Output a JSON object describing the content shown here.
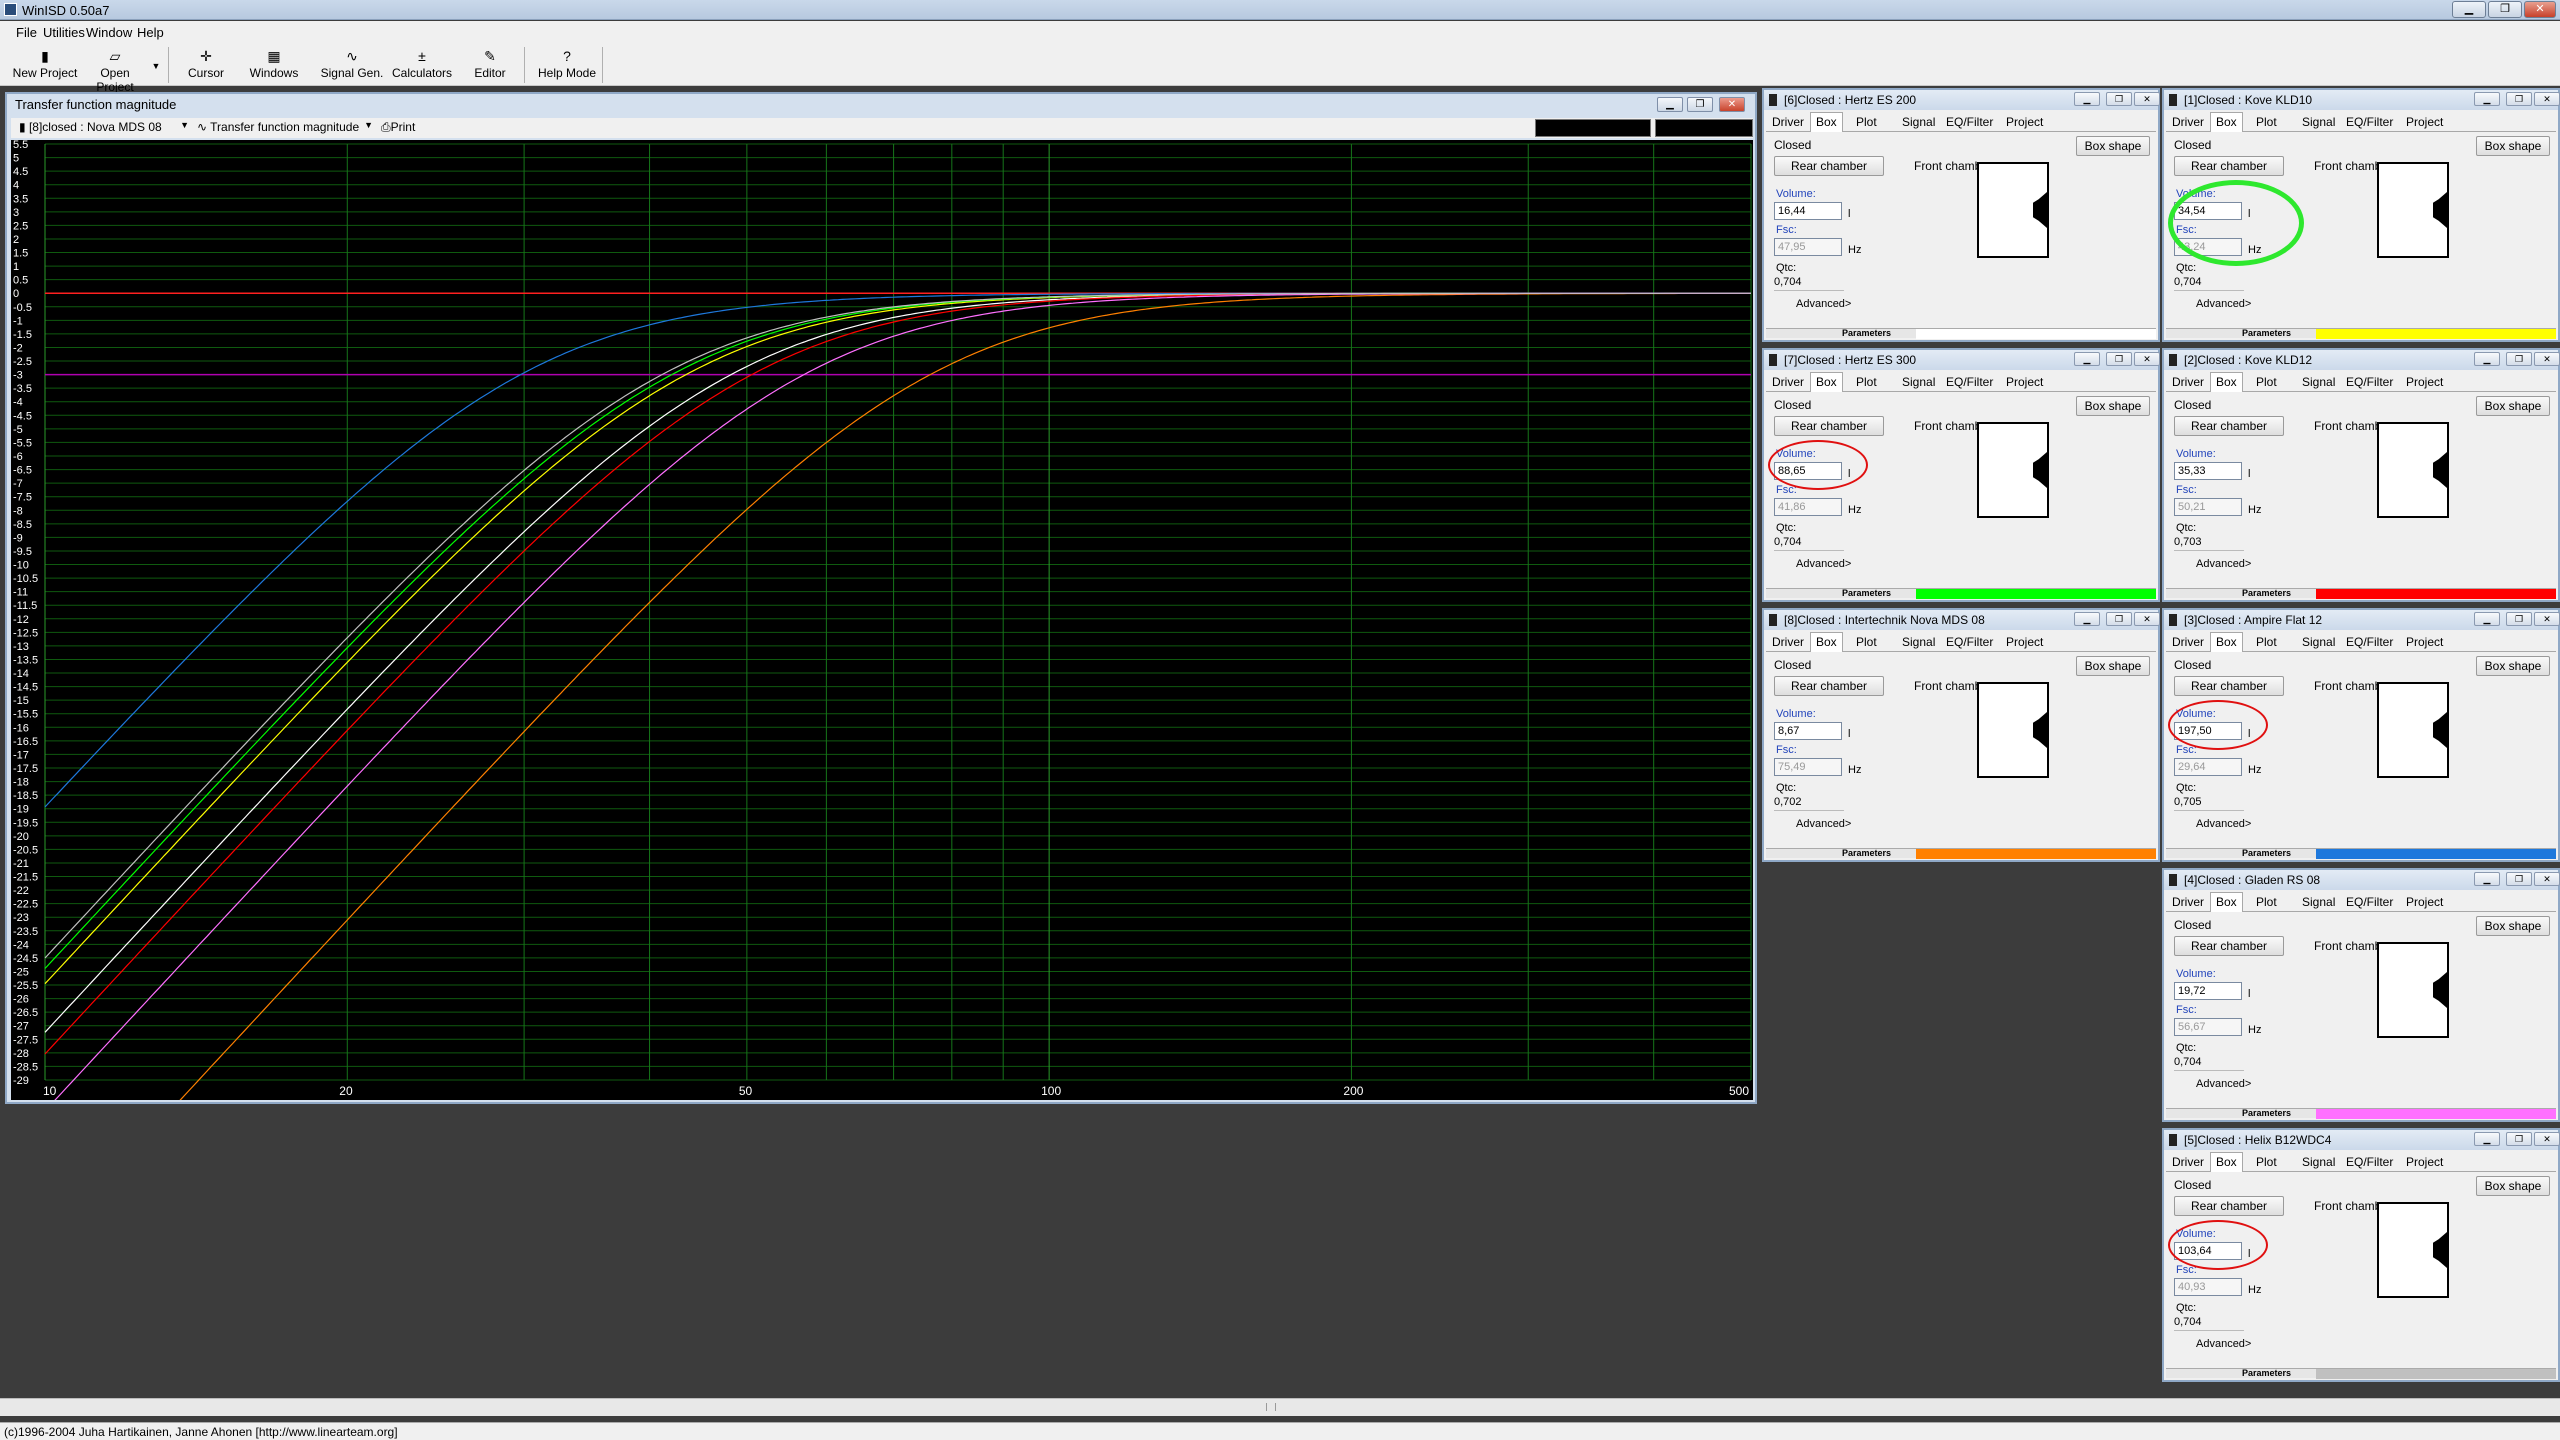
{
  "window": {
    "title": "WinISD 0.50a7"
  },
  "menu": [
    "File",
    "Utilities",
    "Window",
    "Help"
  ],
  "toolbar": {
    "new_project": "New Project",
    "open_project": "Open Project",
    "cursor": "Cursor",
    "windows": "Windows",
    "signal_gen": "Signal Gen.",
    "calculators": "Calculators",
    "editor": "Editor",
    "help_mode": "Help Mode"
  },
  "graph": {
    "title": "Transfer function magnitude",
    "project_select": "[8]closed : Nova MDS 08",
    "graph_select": "Transfer function magnitude",
    "print": "Print",
    "y_ticks": [
      "5.5",
      "5",
      "4.5",
      "4",
      "3.5",
      "3",
      "2.5",
      "2",
      "1.5",
      "1",
      "0.5",
      "0",
      "-0.5",
      "-1",
      "-1.5",
      "-2",
      "-2.5",
      "-3",
      "-3.5",
      "-4",
      "-4.5",
      "-5",
      "-5.5",
      "-6",
      "-6.5",
      "-7",
      "-7.5",
      "-8",
      "-8.5",
      "-9",
      "-9.5",
      "-10",
      "-10.5",
      "-11",
      "-11.5",
      "-12",
      "-12.5",
      "-13",
      "-13.5",
      "-14",
      "-14.5",
      "-15",
      "-15.5",
      "-16",
      "-16.5",
      "-17",
      "-17.5",
      "-18",
      "-18.5",
      "-19",
      "-19.5",
      "-20",
      "-20.5",
      "-21",
      "-21.5",
      "-22",
      "-22.5",
      "-23",
      "-23.5",
      "-24",
      "-24.5",
      "-25",
      "-25.5",
      "-26",
      "-26.5",
      "-27",
      "-27.5",
      "-28",
      "-28.5",
      "-29"
    ],
    "x_ticks": [
      "10",
      "20",
      "50",
      "100",
      "200",
      "500"
    ],
    "scale": {
      "x_log": true,
      "x_range": [
        10,
        500
      ],
      "y_range": [
        -29,
        5.5
      ],
      "y_step": 0.5
    }
  },
  "curves": [
    {
      "name": "[6]Closed : Hertz ES 200",
      "color": "#ffffff",
      "fc": 47.95,
      "qtc": 0.704
    },
    {
      "name": "[1]Closed : Kove KLD10",
      "color": "#ffff00",
      "fc": 43.24,
      "qtc": 0.704
    },
    {
      "name": "[7]Closed : Hertz ES 300",
      "color": "#00ff00",
      "fc": 41.86,
      "qtc": 0.704
    },
    {
      "name": "[2]Closed : Kove KLD12",
      "color": "#ff0000",
      "fc": 50.21,
      "qtc": 0.703
    },
    {
      "name": "[8]Closed : Intertechnik Nova MDS 08",
      "color": "#ff8000",
      "fc": 75.49,
      "qtc": 0.702
    },
    {
      "name": "[3]Closed : Ampire Flat 12",
      "color": "#1e78dc",
      "fc": 29.64,
      "qtc": 0.705
    },
    {
      "name": "[4]Closed : Gladen RS 08",
      "color": "#ff70ff",
      "fc": 56.67,
      "qtc": 0.704
    },
    {
      "name": "[5]Closed : Helix B12WDC4",
      "color": "#c0c0c0",
      "fc": 40.93,
      "qtc": 0.704
    }
  ],
  "common": {
    "tab_driver": "Driver",
    "tab_box": "Box",
    "tab_plot": "Plot",
    "tab_signal": "Signal",
    "tab_eq": "EQ/Filter",
    "tab_project": "Project",
    "closed": "Closed",
    "box_shape": "Box shape",
    "rear_chamber": "Rear chamber",
    "front_chamber": "Front chamber",
    "volume_label": "Volume:",
    "fsc_label": "Fsc:",
    "qtc_label": "Qtc:",
    "unit_l": "l",
    "unit_hz": "Hz",
    "advanced": "Advanced>",
    "parameters": "Parameters"
  },
  "panels": [
    {
      "title": "[6]Closed : Hertz ES 200",
      "volume": "16,44",
      "fsc": "47,95",
      "qtc": "0,704",
      "color": "#ffffff",
      "highlight": ""
    },
    {
      "title": "[1]Closed : Kove KLD10",
      "volume": "34,54",
      "fsc": "43,24",
      "qtc": "0,704",
      "color": "#ffff00",
      "highlight": "#2ee82e"
    },
    {
      "title": "[7]Closed : Hertz ES 300",
      "volume": "88,65",
      "fsc": "41,86",
      "qtc": "0,704",
      "color": "#00ff00",
      "highlight": "#e01010"
    },
    {
      "title": "[2]Closed : Kove KLD12",
      "volume": "35,33",
      "fsc": "50,21",
      "qtc": "0,703",
      "color": "#ff0000",
      "highlight": ""
    },
    {
      "title": "[8]Closed : Intertechnik Nova MDS 08",
      "volume": "8,67",
      "fsc": "75,49",
      "qtc": "0,702",
      "color": "#ff8000",
      "highlight": ""
    },
    {
      "title": "[3]Closed : Ampire Flat 12",
      "volume": "197,50",
      "fsc": "29,64",
      "qtc": "0,705",
      "color": "#1e78dc",
      "highlight": "#e01010"
    },
    {
      "title": "[4]Closed : Gladen RS 08",
      "volume": "19,72",
      "fsc": "56,67",
      "qtc": "0,704",
      "color": "#ff70ff",
      "highlight": ""
    },
    {
      "title": "[5]Closed : Helix B12WDC4",
      "volume": "103,64",
      "fsc": "40,93",
      "qtc": "0,704",
      "color": "#c0c0c0",
      "highlight": "#e01010"
    }
  ],
  "status": "(c)1996-2004 Juha Hartikainen, Janne Ahonen [http://www.linearteam.org]"
}
